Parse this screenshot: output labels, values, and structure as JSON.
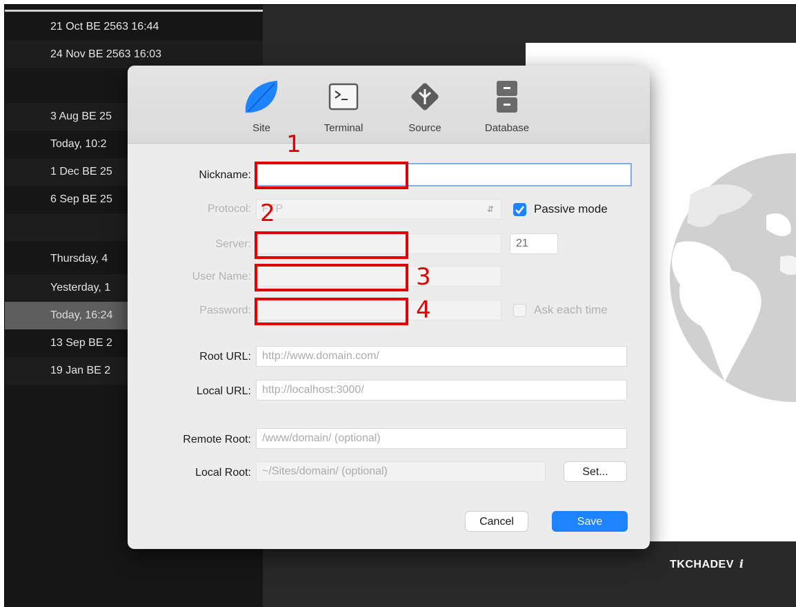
{
  "sidebar": {
    "rows": [
      {
        "label": "21 Oct BE 2563 16:44"
      },
      {
        "label": "24 Nov BE 2563 16:03"
      },
      {
        "label": ""
      },
      {
        "label": "3 Aug BE 25"
      },
      {
        "label": "Today, 10:2"
      },
      {
        "label": "1 Dec BE 25"
      },
      {
        "label": "6 Sep BE 25"
      },
      {
        "label": ""
      },
      {
        "label": "Thursday, 4"
      },
      {
        "label": "Yesterday, 1"
      },
      {
        "label": "Today, 16:24"
      },
      {
        "label": "13 Sep BE 2"
      },
      {
        "label": "19 Jan BE 2"
      }
    ]
  },
  "brand": {
    "name": "TKCHADEV",
    "mark": "i"
  },
  "dialog": {
    "toolbar": {
      "site": "Site",
      "terminal": "Terminal",
      "source": "Source",
      "database": "Database"
    },
    "labels": {
      "nickname": "Nickname:",
      "protocol": "Protocol:",
      "server": "Server:",
      "username": "User Name:",
      "password": "Password:",
      "root_url": "Root URL:",
      "local_url": "Local URL:",
      "remote_root": "Remote Root:",
      "local_root": "Local Root:"
    },
    "values": {
      "protocol": "FTP",
      "port": "21",
      "root_url_placeholder": "http://www.domain.com/",
      "local_url_placeholder": "http://localhost:3000/",
      "remote_root_placeholder": "/www/domain/ (optional)",
      "local_root_placeholder": "~/Sites/domain/ (optional)"
    },
    "checkboxes": {
      "passive_mode": {
        "label": "Passive mode",
        "checked": true
      },
      "ask_each_time": {
        "label": "Ask each time",
        "checked": false
      }
    },
    "buttons": {
      "set": "Set...",
      "cancel": "Cancel",
      "save": "Save"
    }
  },
  "annotations": {
    "n1": "1",
    "n2": "2",
    "n3": "3",
    "n4": "4"
  },
  "colors": {
    "accent": "#1d83ff",
    "annotation": "#e30000"
  }
}
